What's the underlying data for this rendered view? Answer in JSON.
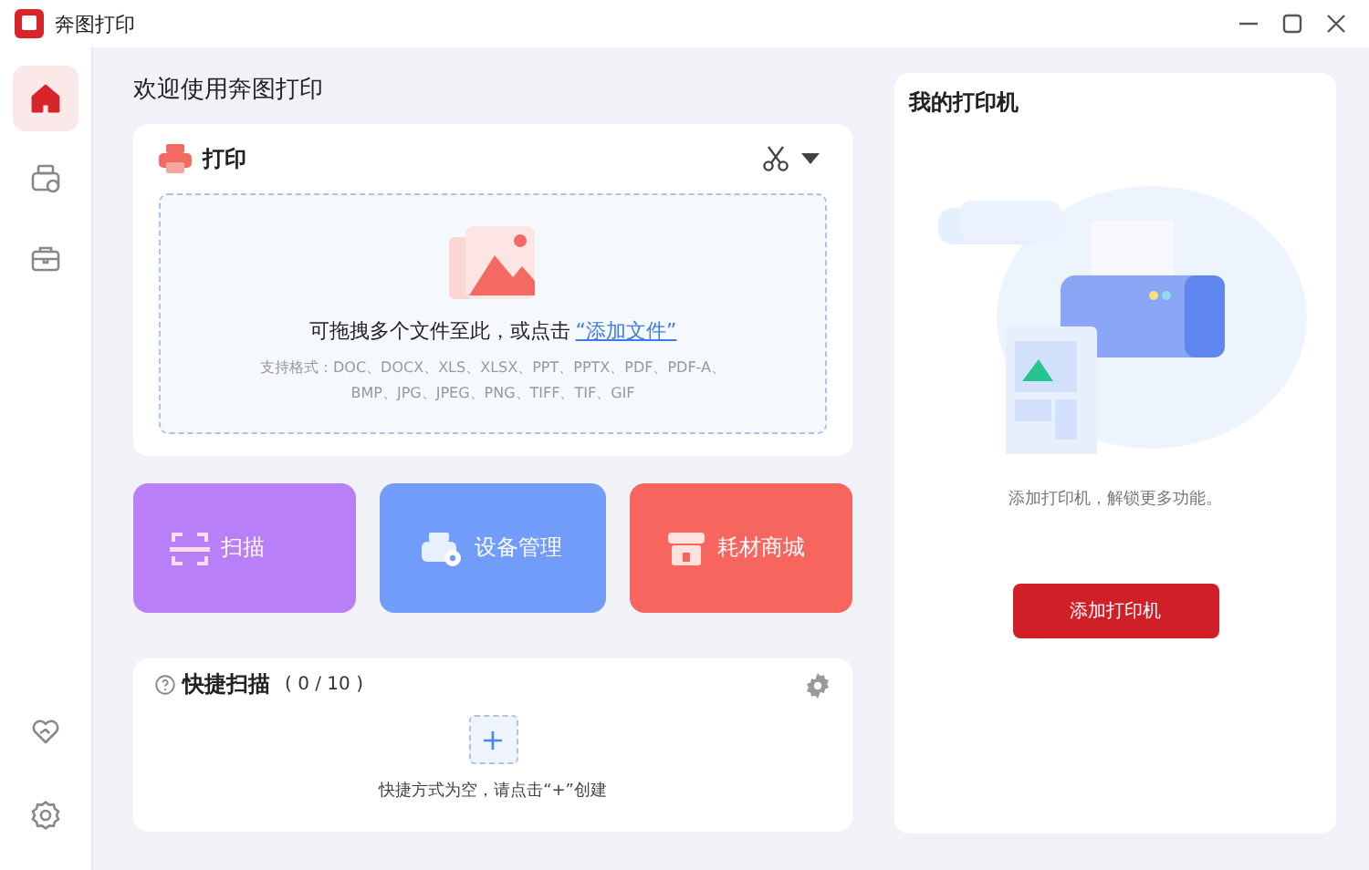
{
  "window": {
    "title": "奔图打印"
  },
  "sidebar": {
    "items": [
      {
        "kind": "home",
        "selected": true
      },
      {
        "kind": "device",
        "selected": false
      },
      {
        "kind": "toolbox",
        "selected": false
      }
    ],
    "bottom_items": [
      {
        "kind": "support"
      },
      {
        "kind": "settings"
      }
    ]
  },
  "heading": "欢迎使用奔图打印",
  "print_card": {
    "title": "打印",
    "drop_text": "可拖拽多个文件至此，或点击",
    "drop_link": "“添加文件”",
    "format_lines": [
      "支持格式：DOC、DOCX、XLS、XLSX、PPT、PPTX、PDF、PDF-A、",
      "BMP、JPG、JPEG、PNG、TIFF、TIF、GIF"
    ]
  },
  "tiles": [
    {
      "kind": "scan",
      "label": "扫描",
      "color": "#b97ff8"
    },
    {
      "kind": "device",
      "label": "设备管理",
      "color": "#729cfa"
    },
    {
      "kind": "store",
      "label": "耗材商城",
      "color": "#f6665e"
    }
  ],
  "quick_scan": {
    "title": "快捷扫描",
    "count": "( 0 / 10 )",
    "add": "+",
    "empty_text": "快捷方式为空，请点击“+”创建"
  },
  "printer_card": {
    "title": "我的打印机",
    "message": "添加打印机，解锁更多功能。",
    "button": "添加打印机"
  }
}
